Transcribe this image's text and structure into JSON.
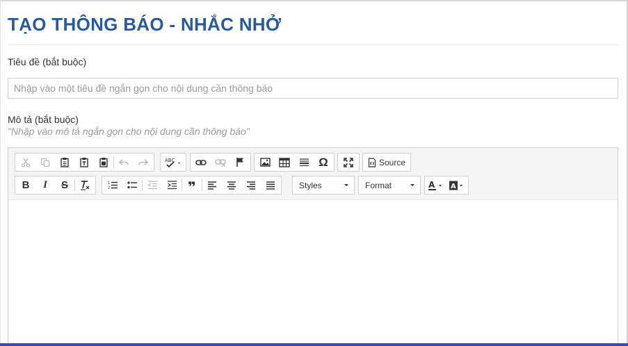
{
  "page": {
    "title": "TẠO THÔNG BÁO - NHẮC NHỞ"
  },
  "form": {
    "title_label": "Tiêu đề (bắt buộc)",
    "title_placeholder": "Nhập vào một tiêu đề ngắn gọn cho nội dung cần thông báo",
    "title_value": "",
    "description_label": "Mô tả (bắt buộc)",
    "description_hint": "\"Nhập vào mô tả ngắn gọn cho nội dung cần thông báo\""
  },
  "editor": {
    "toolbar_row1": [
      "cut-icon",
      "copy-icon",
      "paste-icon",
      "paste-text-icon",
      "paste-word-icon",
      "undo-icon",
      "redo-icon",
      "spellcheck-icon",
      "link-icon",
      "unlink-icon",
      "anchor-flag-icon",
      "image-icon",
      "table-icon",
      "horizontal-line-icon",
      "special-char-omega-icon",
      "maximize-icon",
      "source-icon"
    ],
    "toolbar_row2": [
      "bold-icon",
      "italic-icon",
      "strikethrough-icon",
      "remove-format-icon",
      "numbered-list-icon",
      "bulleted-list-icon",
      "outdent-icon",
      "indent-icon",
      "blockquote-icon",
      "align-left-icon",
      "align-center-icon",
      "align-right-icon",
      "justify-icon",
      "text-color-icon",
      "background-color-icon"
    ],
    "source_label": "Source",
    "styles_label": "Styles",
    "format_label": "Format",
    "spellcheck_glyph": "ABC",
    "omega_glyph": "Ω",
    "quote_glyph": "❞",
    "bold_glyph": "B",
    "italic_glyph": "I",
    "strike_glyph": "S",
    "text_color_glyph": "A",
    "bg_color_glyph": "A",
    "content": ""
  },
  "colors": {
    "title": "#2a5a9a",
    "accent_bar": "#3b4f9e",
    "toolbar_bg": "#f5f5f5"
  }
}
